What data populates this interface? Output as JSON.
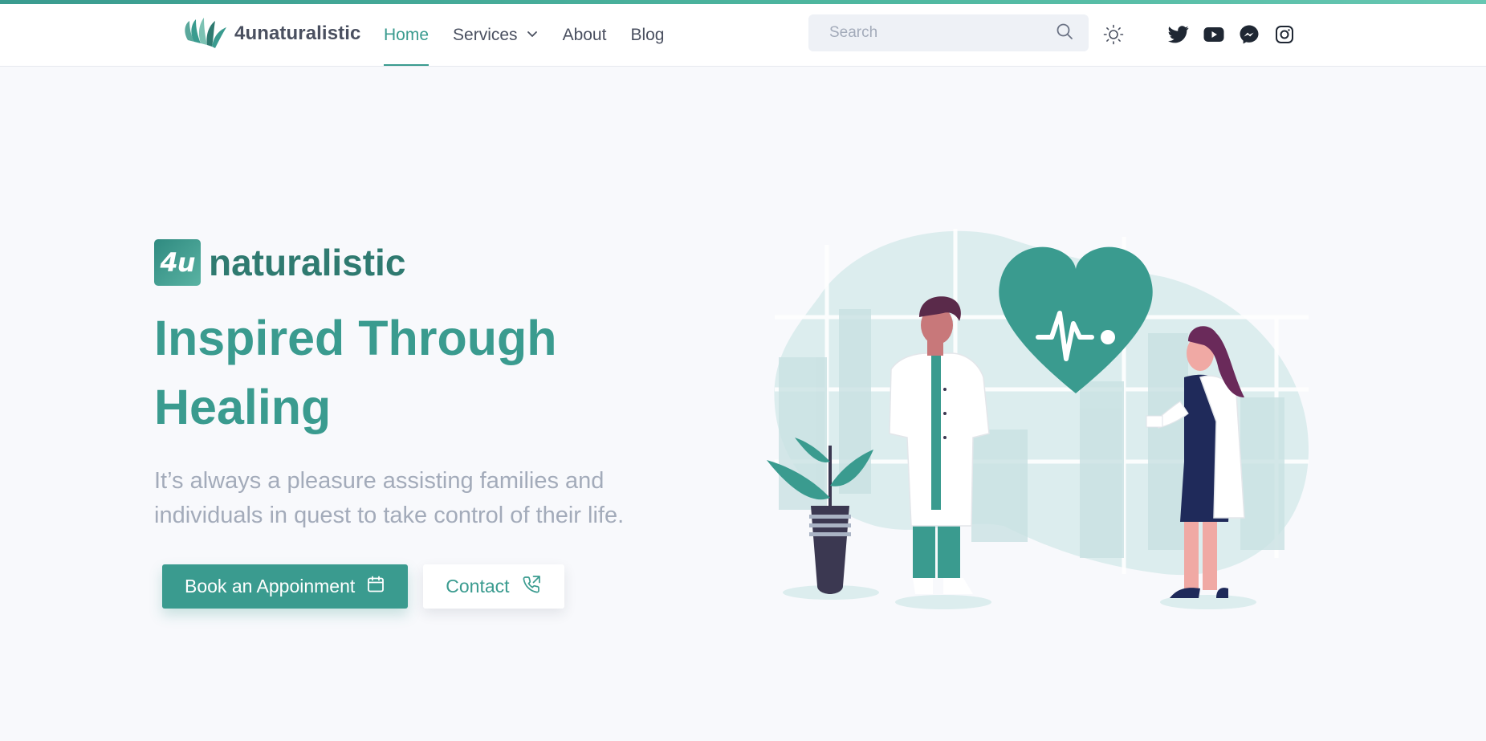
{
  "colors": {
    "accent": "#3a9b8f",
    "accent_dark": "#2f7a70",
    "text": "#4a5060",
    "muted": "#a3abba",
    "background": "#f8f9fc"
  },
  "header": {
    "brand": "4unaturalistic",
    "nav": [
      {
        "label": "Home",
        "active": true
      },
      {
        "label": "Services",
        "has_dropdown": true
      },
      {
        "label": "About"
      },
      {
        "label": "Blog"
      }
    ],
    "search": {
      "placeholder": "Search",
      "value": ""
    },
    "icons": {
      "logo": "leaf-logo-icon",
      "search": "search-icon",
      "theme": "sun-icon",
      "socials": [
        "twitter-icon",
        "youtube-icon",
        "messenger-icon",
        "instagram-icon"
      ]
    }
  },
  "hero": {
    "logo_badge": "4u",
    "logo_word": "naturalistic",
    "title": "Inspired Through Healing",
    "lede": "It’s always a pleasure assisting families and individuals in quest to take control of their life.",
    "primary_cta": "Book an Appoinment",
    "secondary_cta": "Contact",
    "icons": {
      "primary_cta": "calendar-icon",
      "secondary_cta": "phone-outgoing-icon",
      "illustration": "doctors-heart-illustration"
    }
  }
}
